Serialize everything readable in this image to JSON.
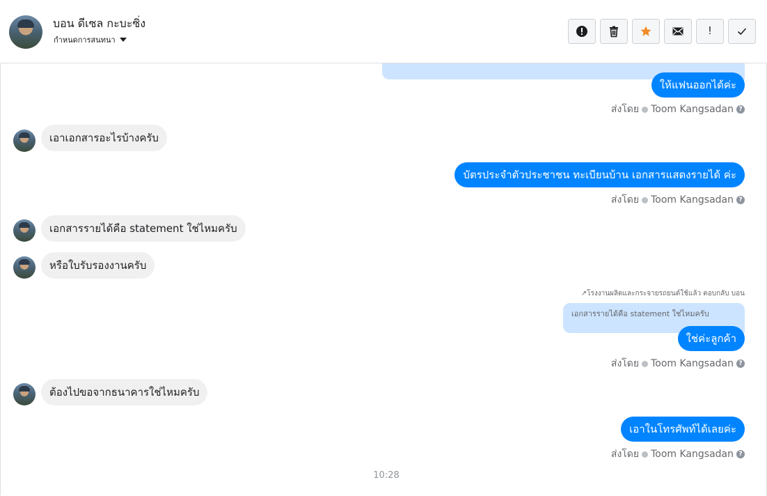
{
  "header": {
    "contact_name": "บอน ดีเซล กะบะซิ่ง",
    "subtitle": "กำหนดการสนทนา",
    "toolbar": [
      {
        "icon": "exclamation-circle-icon"
      },
      {
        "icon": "trash-icon"
      },
      {
        "icon": "star-icon",
        "color": "#f38b27"
      },
      {
        "icon": "envelope-icon"
      },
      {
        "label": "!"
      },
      {
        "icon": "check-icon"
      }
    ]
  },
  "messages": {
    "m0_out": "ให้แฟนออกได้ค่ะ",
    "m1_in": "เอาเอกสารอะไรบ้างครับ",
    "m2_out": "บัตรประจำตัวประชาชน ทะเบียนบ้าน เอกสารแสดงรายได้ ค่ะ",
    "m3_in": "เอกสารรายได้คือ statement ใช่ไหมครับ",
    "m4_in": "หรือใบรับรองงานครับ",
    "m5_reply_note": "โรงงานผลิตและกระจายรถยนต์ใช้แล้ว ตอบกลับ บอน",
    "m5_quote": "เอกสารรายได้คือ statement ใช่ไหมครับ",
    "m5_out": "ใช่ค่ะลูกค้า",
    "m6_in": "ต้องไปขอจากธนาคารใช่ไหมครับ",
    "m7_out": "เอาในโทรศัพท์ได้เลยค่ะ"
  },
  "sent_by": {
    "label": "ส่งโดย",
    "agent": "Toom Kangsadan"
  },
  "timestamp": "10:28",
  "colors": {
    "outgoing_bubble": "#0084ff",
    "incoming_bubble": "#f1f0f0",
    "quote_bg": "#cce4ff"
  }
}
